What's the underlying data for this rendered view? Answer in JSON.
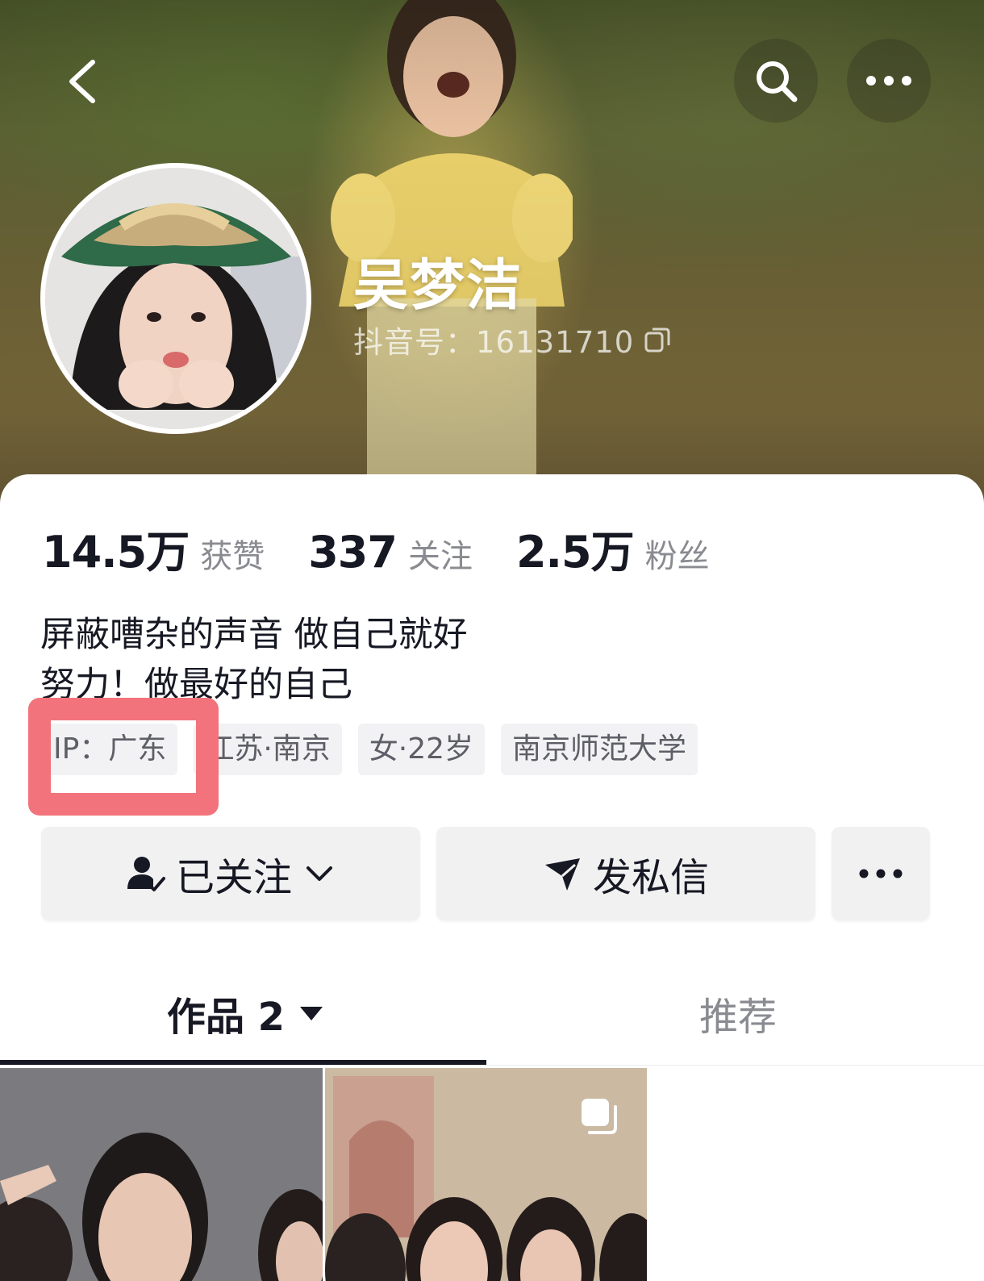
{
  "profile": {
    "nickname": "吴梦洁",
    "douyin_id_text": "抖音号：16131710",
    "bio_lines": [
      "屏蔽嘈杂的声音 做自己就好",
      "努力！做最好的自己"
    ]
  },
  "stats": [
    {
      "value": "14.5万",
      "label": "获赞"
    },
    {
      "value": "337",
      "label": "关注"
    },
    {
      "value": "2.5万",
      "label": "粉丝"
    }
  ],
  "tags": [
    "IP：广东",
    "江苏·南京",
    "女·22岁",
    "南京师范大学"
  ],
  "actions": {
    "follow_label": "已关注",
    "message_label": "发私信"
  },
  "tabs": {
    "works_label": "作品 2",
    "recommend_label": "推荐"
  },
  "icons": {
    "back": "chevron-left-icon",
    "search": "search-icon",
    "more": "more-dots-icon",
    "copy": "copy-icon",
    "follow_user": "user-check-icon",
    "send": "send-icon",
    "dropdown": "caret-down-icon",
    "multi_image": "multi-image-icon"
  },
  "colors": {
    "highlight": "#f2737b",
    "text_primary": "#161823",
    "text_secondary": "#8a8b91",
    "tag_bg": "#f2f2f4",
    "button_bg": "#f1f1f2"
  }
}
